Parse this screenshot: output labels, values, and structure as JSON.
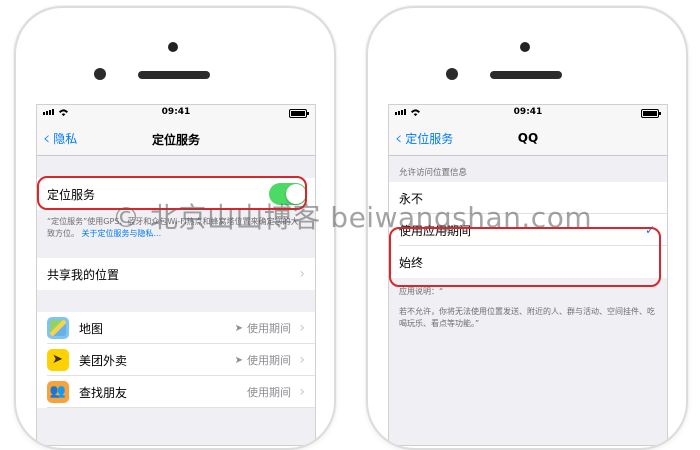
{
  "left_screen": {
    "status_time": "09:41",
    "back_label": "隐私",
    "title": "定位服务",
    "location_services_label": "定位服务",
    "location_services_on": true,
    "footnote_text": "“定位服务”使用GPS、蓝牙和众包Wi-Fi热点和蜂窝塔位置来确定您的大致方位。",
    "footnote_link": "关于定位服务与隐私...",
    "share_location_label": "共享我的位置",
    "apps": [
      {
        "name": "地图",
        "icon": "maps-icon",
        "detail": "使用期间",
        "arrow": true
      },
      {
        "name": "美团外卖",
        "icon": "meituan-icon",
        "detail": "使用期间",
        "arrow": true
      },
      {
        "name": "查找朋友",
        "icon": "find-friends-icon",
        "detail": "使用期间",
        "arrow": false
      }
    ]
  },
  "right_screen": {
    "status_time": "09:41",
    "back_label": "定位服务",
    "title": "QQ",
    "section_header": "允许访问位置信息",
    "options": [
      {
        "label": "永不",
        "selected": false
      },
      {
        "label": "使用应用期间",
        "selected": true
      },
      {
        "label": "始终",
        "selected": false
      }
    ],
    "app_description_label": "应用说明：“",
    "explanation": "若不允许，你将无法使用位置发送、附近的人、群与活动、空间挂件、吃喝玩乐、看点等功能。”"
  },
  "watermark": "© 北京山山博客 beiwangshan.com",
  "colors": {
    "ios_blue": "#007aff",
    "toggle_green": "#4cd964",
    "highlight_red": "#d9262b"
  }
}
